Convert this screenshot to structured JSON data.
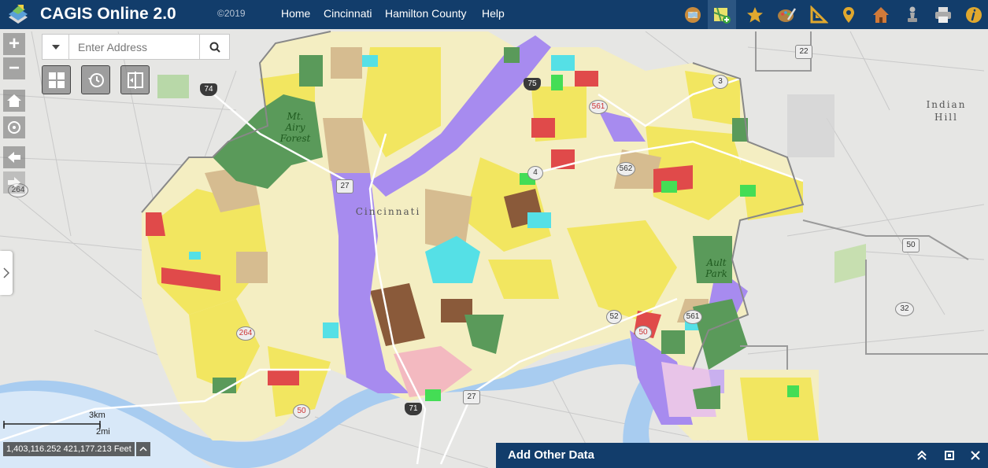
{
  "header": {
    "title": "CAGIS Online 2.0",
    "copyright": "©2019",
    "nav": [
      {
        "label": "Home"
      },
      {
        "label": "Cincinnati"
      },
      {
        "label": "Hamilton County"
      },
      {
        "label": "Help"
      }
    ],
    "tools": [
      {
        "icon": "layers-map-icon"
      },
      {
        "icon": "add-data-icon",
        "active": true
      },
      {
        "icon": "star-icon"
      },
      {
        "icon": "palette-icon"
      },
      {
        "icon": "measure-icon"
      },
      {
        "icon": "location-pin-icon"
      },
      {
        "icon": "home-icon"
      },
      {
        "icon": "chess-pawn-icon"
      },
      {
        "icon": "print-icon"
      },
      {
        "icon": "info-icon"
      }
    ]
  },
  "search": {
    "placeholder": "Enter Address"
  },
  "map": {
    "labels": {
      "mt_airy": "Mt.\nAiry\nForest",
      "cincinnati": "Cincinnati",
      "ault_park": "Ault\nPark",
      "indian_hill": "Indian\nHill"
    },
    "routes": [
      "74",
      "27",
      "75",
      "561",
      "562",
      "4",
      "22",
      "3",
      "264",
      "50",
      "32",
      "71",
      "52",
      "561",
      "50",
      "27",
      "561",
      "50",
      "264"
    ]
  },
  "scale": {
    "km": "3km",
    "mi": "2mi"
  },
  "coordinates": "1,403,116.252 421,177.213 Feet",
  "panel": {
    "title": "Add Other Data"
  },
  "colors": {
    "header_bg": "#123d6b",
    "river": "#a8ccf0",
    "park": "#5a9a5a",
    "residential": "#f2e660",
    "commercial": "#e04a4a",
    "industrial": "#a78bef",
    "institutional": "#55e0e6",
    "land_other": "#d6bc90"
  }
}
